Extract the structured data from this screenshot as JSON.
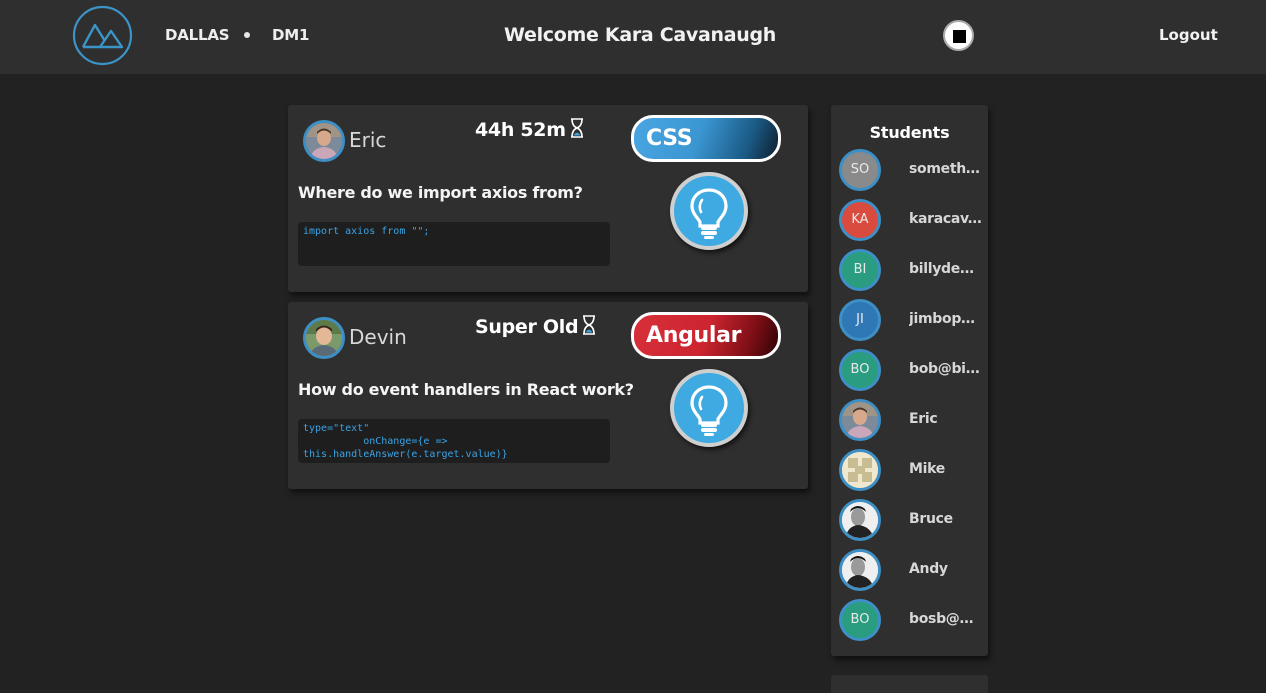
{
  "header": {
    "campus": "DALLAS",
    "cohort": "DM1",
    "welcome": "Welcome Kara Cavanaugh",
    "logout_label": "Logout"
  },
  "questions": [
    {
      "author": "Eric",
      "timer": "44h 52m",
      "question": "Where do we import axios from?",
      "code": "import axios from \"\";",
      "tag": "CSS",
      "tag_color": "#4aa6e2",
      "icon": "lightbulb-icon"
    },
    {
      "author": "Devin",
      "timer": "Super Old",
      "question": "How do event handlers in React work?",
      "code": "type=\"text\"\n          onChange={e =>\nthis.handleAnswer(e.target.value)}",
      "tag": "Angular",
      "tag_color": "#d83039",
      "icon": "lightbulb-icon"
    }
  ],
  "students_panel": {
    "title": "Students",
    "students": [
      {
        "initials": "SO",
        "name": "somethin...",
        "color": "#8a8a8a"
      },
      {
        "initials": "KA",
        "name": "karacav...",
        "color": "#d94b3f"
      },
      {
        "initials": "BI",
        "name": "billydean...",
        "color": "#2a9d80"
      },
      {
        "initials": "JI",
        "name": "jimbopa...",
        "color": "#2f78b5"
      },
      {
        "initials": "BO",
        "name": "bob@bill...",
        "color": "#2a9d80"
      },
      {
        "initials": "",
        "name": "Eric",
        "color": "#8a7768"
      },
      {
        "initials": "",
        "name": "Mike",
        "color": "#d8cfa8"
      },
      {
        "initials": "",
        "name": "Bruce",
        "color": "#ededed"
      },
      {
        "initials": "",
        "name": "Andy",
        "color": "#ededed"
      },
      {
        "initials": "BO",
        "name": "bosb@bi...",
        "color": "#2a9d80"
      }
    ]
  },
  "colors": {
    "background": "#222222",
    "card": "#2f2f2f",
    "accent_blue": "#3fa9e2",
    "code_text": "#3aa3e6"
  }
}
